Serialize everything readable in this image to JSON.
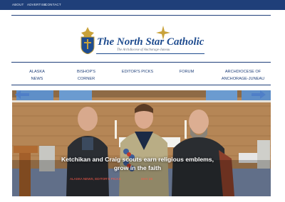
{
  "topbar": {
    "links": [
      "ABOUT",
      "ADVERTISE",
      "CONTACT"
    ]
  },
  "logo": {
    "title": "The North Star Catholic",
    "subtitle": "The Archdiocese of Anchorage-Juneau"
  },
  "nav": {
    "items": [
      {
        "label": "ALASKA NEWS"
      },
      {
        "label": "BISHOP'S CORNER"
      },
      {
        "label": "EDITOR'S PICKS"
      },
      {
        "label": "FORUM"
      },
      {
        "label": "ARCHDIOCESE OF ANCHORAGE-JUNEAU"
      }
    ]
  },
  "featured": {
    "headline": "Ketchikan and Craig scouts earn religious emblems, grow in the faith",
    "categories": "ALASKA NEWS, EDITOR'S PICKS",
    "date": "MAY 26"
  },
  "colors": {
    "brand_navy": "#1f3f79",
    "logo_blue": "#1f4c8f",
    "gold": "#c9a23a",
    "meta_red": "#ff5a4a"
  },
  "icons": {
    "prev": "arrow-left-icon",
    "next": "arrow-right-icon",
    "logo": "crest-icon",
    "star": "star-icon"
  }
}
